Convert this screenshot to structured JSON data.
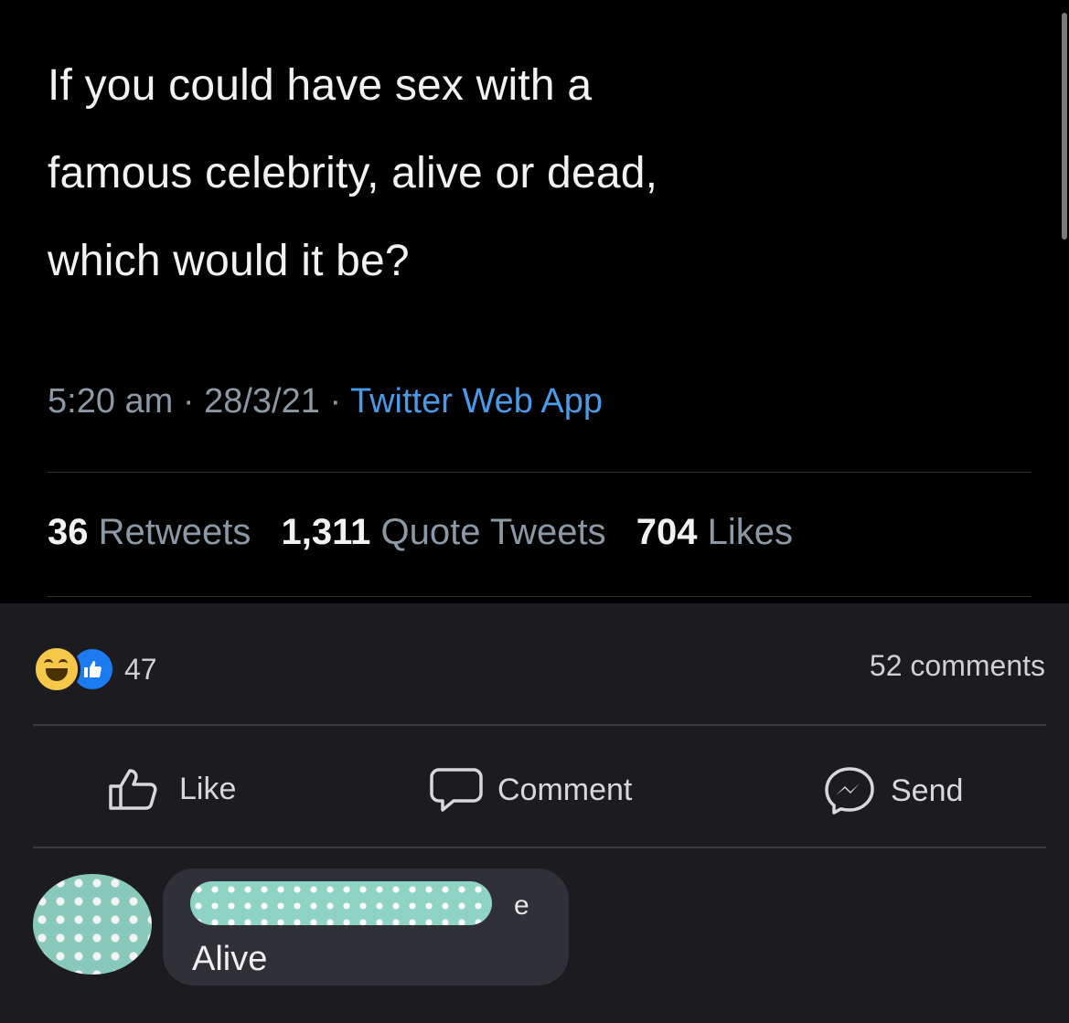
{
  "tweet": {
    "text": "If you could have sex with a\nfamous celebrity, alive or dead,\nwhich would it be?",
    "time": "5:20 am",
    "date": "28/3/21",
    "separator": "·",
    "source": "Twitter Web App",
    "stats": {
      "retweets_count": "36",
      "retweets_label": "Retweets",
      "quotes_count": "1,311",
      "quotes_label": "Quote Tweets",
      "likes_count": "704",
      "likes_label": "Likes"
    }
  },
  "facebook": {
    "reaction_count": "47",
    "comments_count_label": "52 comments",
    "actions": {
      "like": "Like",
      "comment": "Comment",
      "send": "Send"
    },
    "comment": {
      "name_visible_fragment": "e",
      "text": "Alive"
    },
    "colors": {
      "link_blue": "#4a9ae8",
      "like_blue": "#1d7bf2",
      "haha_yellow": "#f6c84a",
      "redaction_teal": "#8fd3c3"
    }
  }
}
